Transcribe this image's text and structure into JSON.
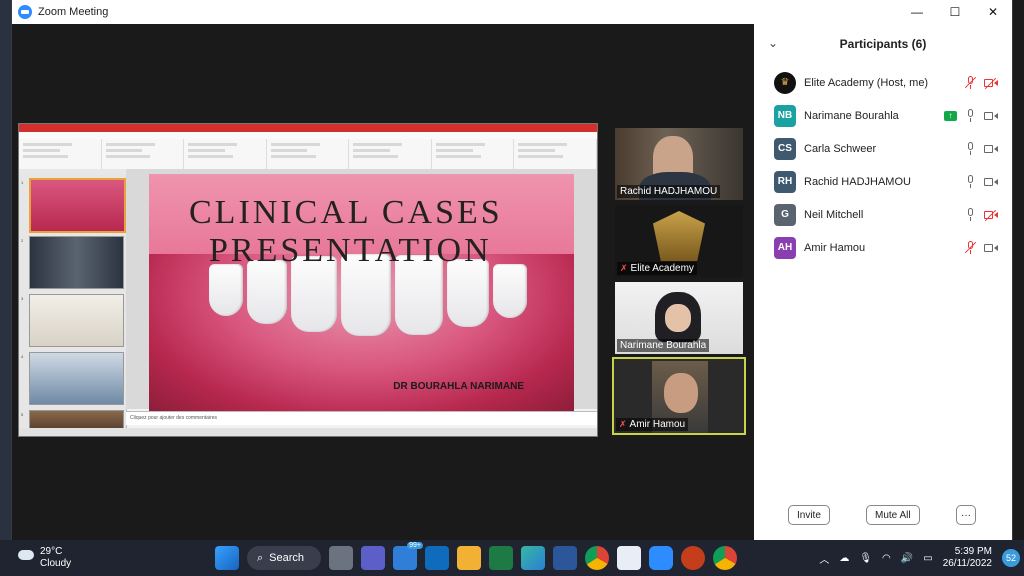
{
  "window": {
    "title": "Zoom Meeting",
    "minimize": "—",
    "maximize": "☐",
    "close": "✕"
  },
  "presentation": {
    "slide_title_line1": "CLINICAL CASES",
    "slide_title_line2": "PRESENTATION",
    "slide_author": "DR BOURAHLA NARIMANE",
    "notes_placeholder": "Cliquez pour ajouter des commentaires",
    "thumb_numbers": [
      "1",
      "2",
      "3",
      "4",
      "5"
    ]
  },
  "videos": [
    {
      "name": "Rachid HADJHAMOU",
      "muted": false
    },
    {
      "name": "Elite Academy",
      "muted": true
    },
    {
      "name": "Narimane Bourahla",
      "muted": false
    },
    {
      "name": "Amir Hamou",
      "muted": true
    }
  ],
  "participants_panel": {
    "title": "Participants (6)",
    "collapse_icon": "chevron-down-icon",
    "participants": [
      {
        "name": "Elite Academy (Host, me)",
        "initials": "",
        "avatar_color": "#111111",
        "mic_muted": true,
        "video_off": true,
        "sharing": false
      },
      {
        "name": "Narimane Bourahla",
        "initials": "NB",
        "avatar_color": "#1aa1a1",
        "mic_muted": false,
        "video_off": false,
        "sharing": true
      },
      {
        "name": "Carla Schweer",
        "initials": "CS",
        "avatar_color": "#3f5a6e",
        "mic_muted": false,
        "video_off": false,
        "sharing": false
      },
      {
        "name": "Rachid HADJHAMOU",
        "initials": "RH",
        "avatar_color": "#3f5a6e",
        "mic_muted": false,
        "video_off": false,
        "sharing": false
      },
      {
        "name": "Neil Mitchell",
        "initials": "G",
        "avatar_color": "#5a6470",
        "mic_muted": false,
        "video_off": true,
        "sharing": false
      },
      {
        "name": "Amir Hamou",
        "initials": "AH",
        "avatar_color": "#8a3fb0",
        "mic_muted": true,
        "video_off": false,
        "sharing": false
      }
    ],
    "invite_label": "Invite",
    "mute_all_label": "Mute All",
    "more_label": "···"
  },
  "taskbar": {
    "weather_temp": "29°C",
    "weather_desc": "Cloudy",
    "search_label": "Search",
    "mail_badge": "99+",
    "time": "5:39 PM",
    "date": "26/11/2022",
    "notification_count": "52"
  }
}
